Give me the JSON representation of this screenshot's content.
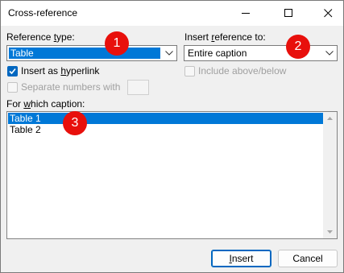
{
  "window": {
    "title": "Cross-reference"
  },
  "reference_type": {
    "label_prefix": "Reference ",
    "label_underlined": "t",
    "label_suffix": "ype:",
    "value": "Table"
  },
  "insert_reference_to": {
    "label_prefix": "Insert ",
    "label_underlined": "r",
    "label_suffix": "eference to:",
    "value": "Entire caption"
  },
  "insert_as_hyperlink": {
    "label_prefix": "Insert as ",
    "label_underlined": "h",
    "label_suffix": "yperlink",
    "checked": true
  },
  "include_above_below": {
    "label": "Include above/below",
    "checked": false,
    "enabled": false
  },
  "separate_numbers": {
    "label": "Separate numbers with",
    "checked": false,
    "enabled": false
  },
  "for_which_caption": {
    "label_prefix": "For ",
    "label_underlined": "w",
    "label_suffix": "hich caption:",
    "items": [
      "Table 1",
      "Table 2"
    ],
    "selected_index": 0
  },
  "buttons": {
    "insert_underlined": "I",
    "insert_rest": "nsert",
    "cancel": "Cancel"
  },
  "annotations": [
    "1",
    "2",
    "3"
  ],
  "colors": {
    "selection": "#0078d7",
    "badge": "#e8100c",
    "accent": "#0067c0"
  }
}
